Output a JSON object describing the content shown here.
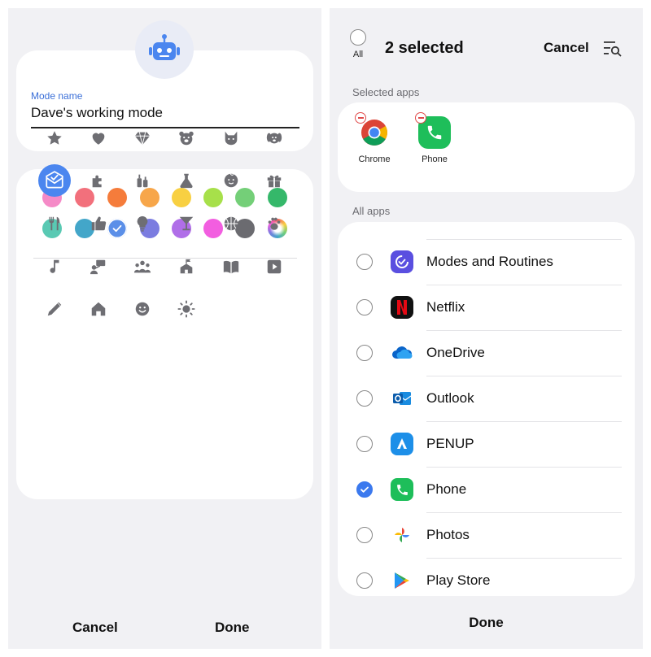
{
  "left": {
    "mode_name_label": "Mode name",
    "mode_name_value": "Dave's working mode",
    "colors": [
      "#f58ac7",
      "#f2707c",
      "#f57c3b",
      "#f7a64a",
      "#f8d042",
      "#a7e04a",
      "#74cf78",
      "#35b86a",
      "#59c9b3",
      "#43a6c9",
      "#5b8fe8",
      "#7b7ce0",
      "#b06ee8",
      "#f25ee0",
      "#6b6b70",
      "conic"
    ],
    "selected_color_index": 10,
    "icons": [
      "star",
      "heart",
      "gem",
      "bear",
      "cat",
      "dog",
      "check-envelope",
      "puzzle",
      "bottles",
      "flask",
      "baby",
      "gift",
      "fork-knife",
      "thumbs-up",
      "bulb",
      "cocktail",
      "basketball",
      "paw",
      "music",
      "presenter",
      "group",
      "school",
      "book",
      "play",
      "pencil",
      "home",
      "smile",
      "sun"
    ],
    "selected_icon_index": 6,
    "cancel_label": "Cancel",
    "done_label": "Done"
  },
  "right": {
    "all_label": "All",
    "title": "2 selected",
    "cancel_label": "Cancel",
    "selected_apps_label": "Selected apps",
    "selected_apps": [
      {
        "name": "Chrome",
        "icon": "chrome"
      },
      {
        "name": "Phone",
        "icon": "phone"
      }
    ],
    "all_apps_label": "All apps",
    "apps": [
      {
        "name": "Modes and Routines",
        "icon": "modes",
        "checked": false
      },
      {
        "name": "Netflix",
        "icon": "netflix",
        "checked": false
      },
      {
        "name": "OneDrive",
        "icon": "onedrive",
        "checked": false
      },
      {
        "name": "Outlook",
        "icon": "outlook",
        "checked": false
      },
      {
        "name": "PENUP",
        "icon": "penup",
        "checked": false
      },
      {
        "name": "Phone",
        "icon": "phone",
        "checked": true
      },
      {
        "name": "Photos",
        "icon": "photos",
        "checked": false
      },
      {
        "name": "Play Store",
        "icon": "playstore",
        "checked": false
      }
    ],
    "done_label": "Done"
  },
  "colors": {
    "accent": "#3b79ee",
    "icon_gray": "#6e6e73",
    "panel_bg": "#f1f1f4"
  }
}
